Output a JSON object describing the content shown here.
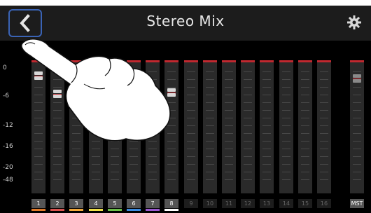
{
  "header": {
    "title": "Stereo Mix",
    "back_icon": "chevron-left-icon",
    "settings_icon": "gear-icon"
  },
  "scale_labels": [
    "0",
    "-6",
    "-12",
    "-16",
    "-20",
    "-48"
  ],
  "channels": [
    {
      "label": "1",
      "color": "#e07a2a",
      "active": true
    },
    {
      "label": "2",
      "color": "#d9534f",
      "active": true
    },
    {
      "label": "3",
      "color": "#f2a93b",
      "active": true
    },
    {
      "label": "4",
      "color": "#f0e14a",
      "active": true
    },
    {
      "label": "5",
      "color": "#6cbf4a",
      "active": true
    },
    {
      "label": "6",
      "color": "#3c8be0",
      "active": true
    },
    {
      "label": "7",
      "color": "#9b59d0",
      "active": true
    },
    {
      "label": "8",
      "color": "#ffffff",
      "active": true
    },
    {
      "label": "9",
      "color": "",
      "active": false
    },
    {
      "label": "10",
      "color": "",
      "active": false
    },
    {
      "label": "11",
      "color": "",
      "active": false
    },
    {
      "label": "12",
      "color": "",
      "active": false
    },
    {
      "label": "13",
      "color": "",
      "active": false
    },
    {
      "label": "14",
      "color": "",
      "active": false
    },
    {
      "label": "15",
      "color": "",
      "active": false
    },
    {
      "label": "16",
      "color": "",
      "active": false
    },
    {
      "label": "MST",
      "color": "",
      "active": true
    }
  ],
  "accent": {
    "highlight": "#3a63b5",
    "clip": "#c0282f"
  }
}
